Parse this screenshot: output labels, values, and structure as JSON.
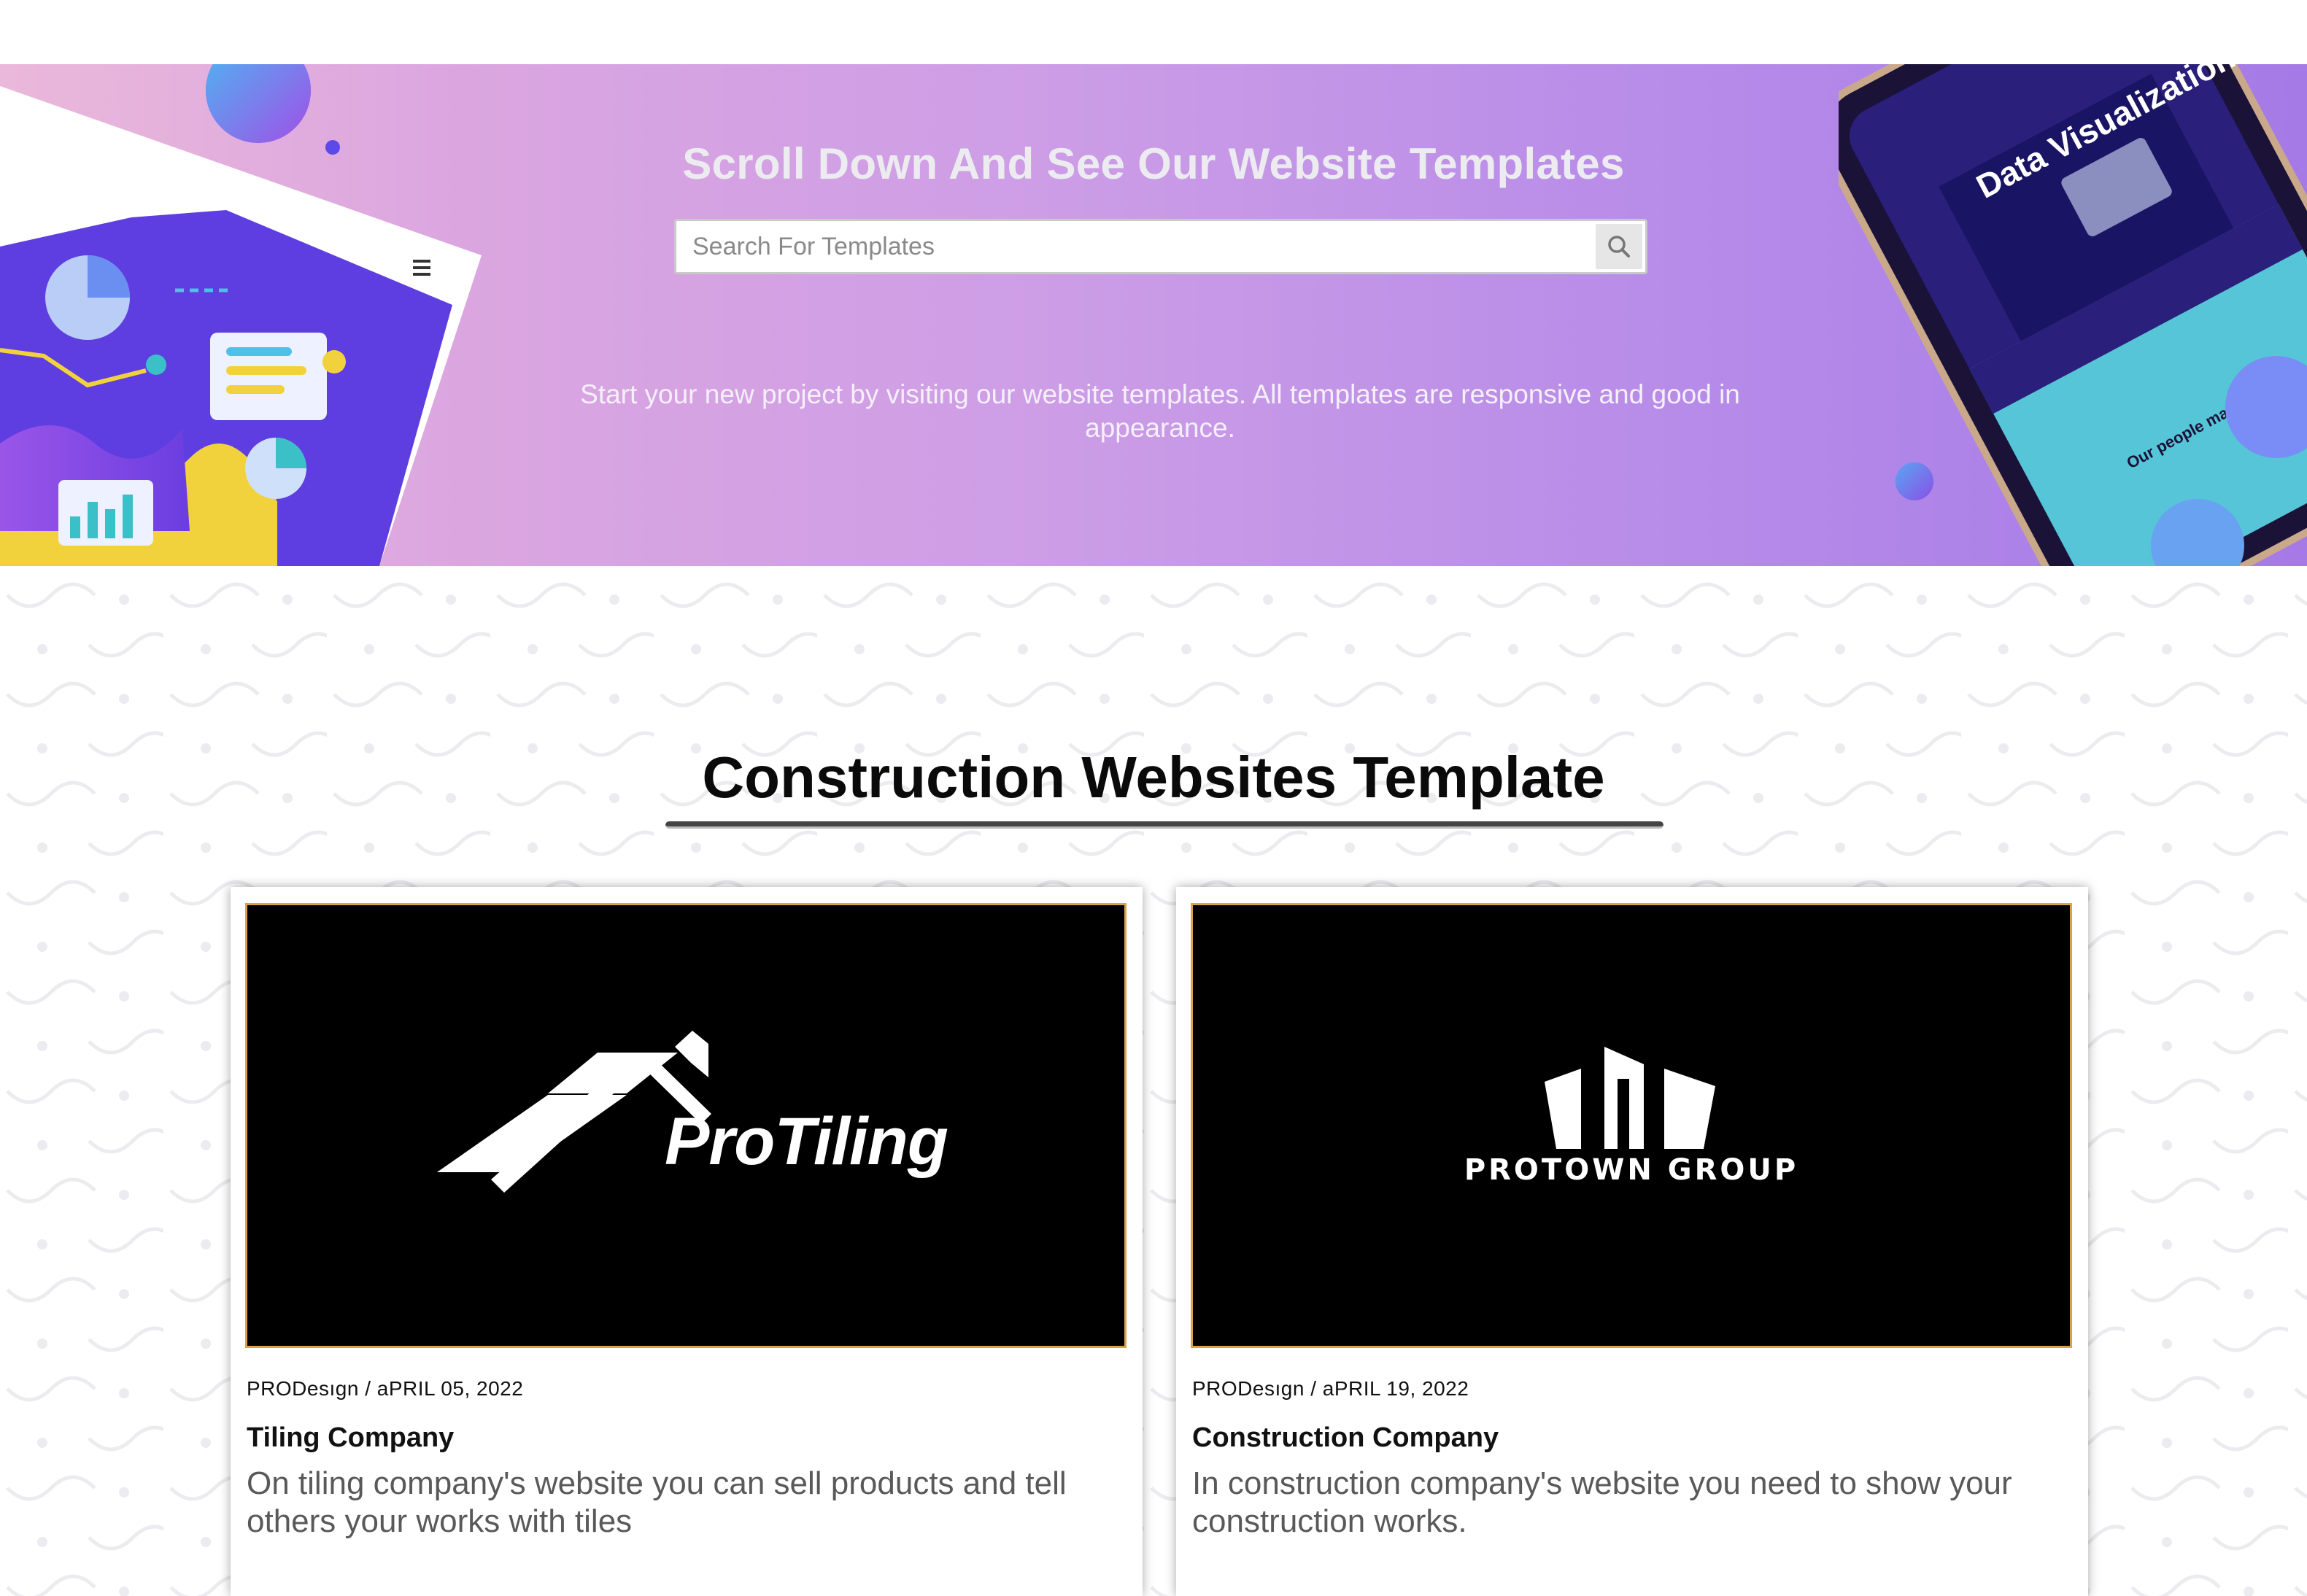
{
  "hero": {
    "title": "Scroll Down And See Our Website Templates",
    "search_placeholder": "Search For Templates",
    "description": "Start your new project by visiting our website templates. All templates are responsive and good in appearance.",
    "phone_texts": [
      "Data Visualization",
      "Our people make"
    ]
  },
  "section": {
    "title": "Construction Websites Template"
  },
  "cards": [
    {
      "logo_text": "ProTiling",
      "author": "PRODesıgn",
      "date": "aPRIL 05, 2022",
      "title": "Tiling Company",
      "excerpt": "On tiling company's website you can sell products and tell others your works with tiles"
    },
    {
      "logo_text": "PROTOWN GROUP",
      "author": "PRODesıgn",
      "date": "aPRIL 19, 2022",
      "title": "Construction Company",
      "excerpt": "In construction company's website you need to show your construction works."
    }
  ],
  "colors": {
    "hero_gradient_start": "#eab8da",
    "hero_gradient_end": "#a57ae6",
    "thumb_border": "#d8a24a",
    "excerpt_text": "#595959"
  }
}
